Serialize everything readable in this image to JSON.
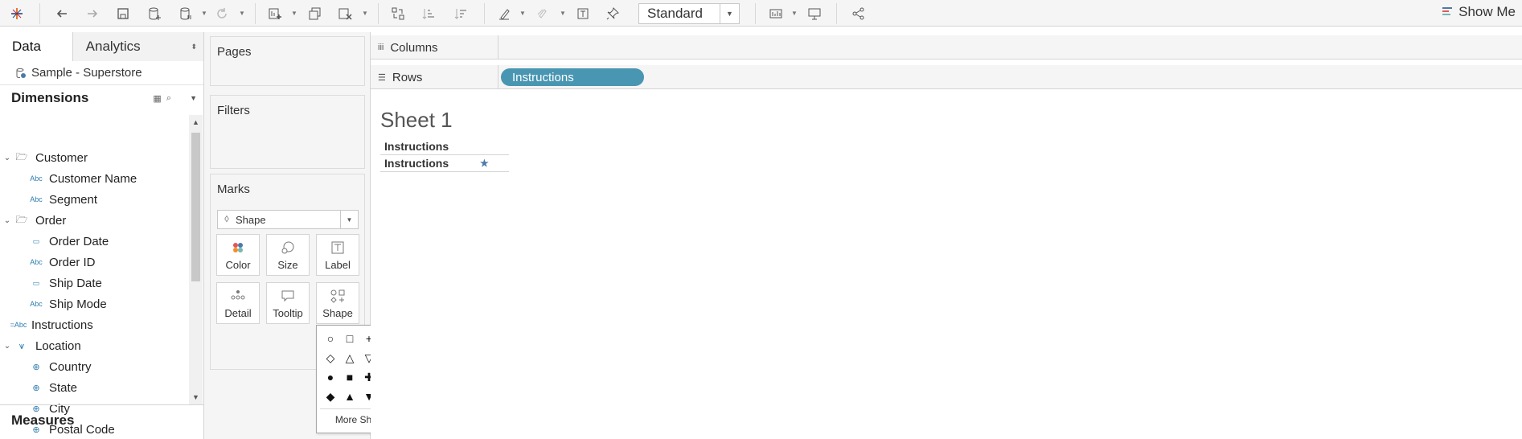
{
  "toolbar": {
    "fit_mode": "Standard",
    "show_me": "Show Me"
  },
  "datapane": {
    "tab_data": "Data",
    "tab_analytics": "Analytics",
    "datasource": "Sample - Superstore",
    "dimensions_header": "Dimensions",
    "measures_header": "Measures",
    "fields": [
      {
        "label": "Customer"
      },
      {
        "label": "Customer Name"
      },
      {
        "label": "Segment"
      },
      {
        "label": "Order"
      },
      {
        "label": "Order Date"
      },
      {
        "label": "Order ID"
      },
      {
        "label": "Ship Date"
      },
      {
        "label": "Ship Mode"
      },
      {
        "label": "Instructions"
      },
      {
        "label": "Location"
      },
      {
        "label": "Country"
      },
      {
        "label": "State"
      },
      {
        "label": "City"
      },
      {
        "label": "Postal Code"
      }
    ]
  },
  "cards": {
    "pages": "Pages",
    "filters": "Filters",
    "marks": "Marks",
    "mark_type": "Shape",
    "buttons": {
      "color": "Color",
      "size": "Size",
      "label": "Label",
      "detail": "Detail",
      "tooltip": "Tooltip",
      "shape": "Shape"
    }
  },
  "shape_popup": {
    "shapes": [
      "○",
      "□",
      "+",
      "✕",
      "✱",
      "◇",
      "△",
      "▽",
      "◁",
      "▷",
      "●",
      "■",
      "✚",
      "✖",
      "★",
      "◆",
      "▲",
      "▼",
      "◀",
      "▶"
    ],
    "selected_index": 14,
    "more": "More Shapes..."
  },
  "shelves": {
    "columns": "Columns",
    "rows": "Rows",
    "rows_pill": "Instructions"
  },
  "sheet": {
    "title": "Sheet 1",
    "header": "Instructions",
    "row_value": "Instructions",
    "mark_glyph": "★"
  }
}
